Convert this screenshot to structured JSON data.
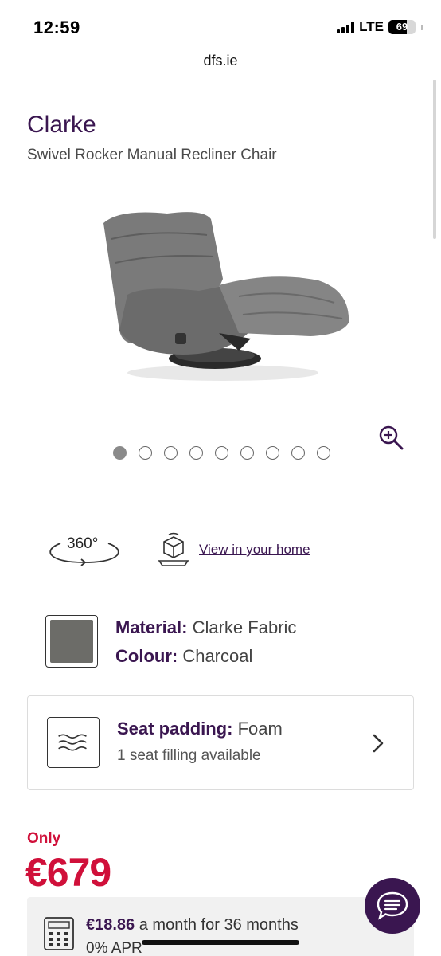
{
  "status_bar": {
    "time": "12:59",
    "network": "LTE",
    "battery": "69",
    "battery_level": 0.69
  },
  "browser": {
    "url": "dfs.ie"
  },
  "product": {
    "title": "Clarke",
    "subtitle": "Swivel Rocker Manual Recliner Chair",
    "image_alt": "chair-image",
    "dot_count": 9,
    "active_dot": 0
  },
  "actions": {
    "view360_label": "360°",
    "ar_label": "View in your home"
  },
  "material": {
    "material_label": "Material:",
    "material_value": " Clarke Fabric",
    "colour_label": "Colour:",
    "colour_value": " Charcoal",
    "swatch_color": "#6c6c68"
  },
  "seat_padding": {
    "label": "Seat padding:",
    "value": " Foam",
    "subtext": "1 seat filling available"
  },
  "pricing": {
    "only_label": "Only",
    "price": "€679",
    "monthly_amount": "€18.86",
    "monthly_text": " a month for 36 months",
    "apr": "0% APR"
  },
  "colors": {
    "brand": "#3a1650",
    "price": "#d0103a"
  }
}
